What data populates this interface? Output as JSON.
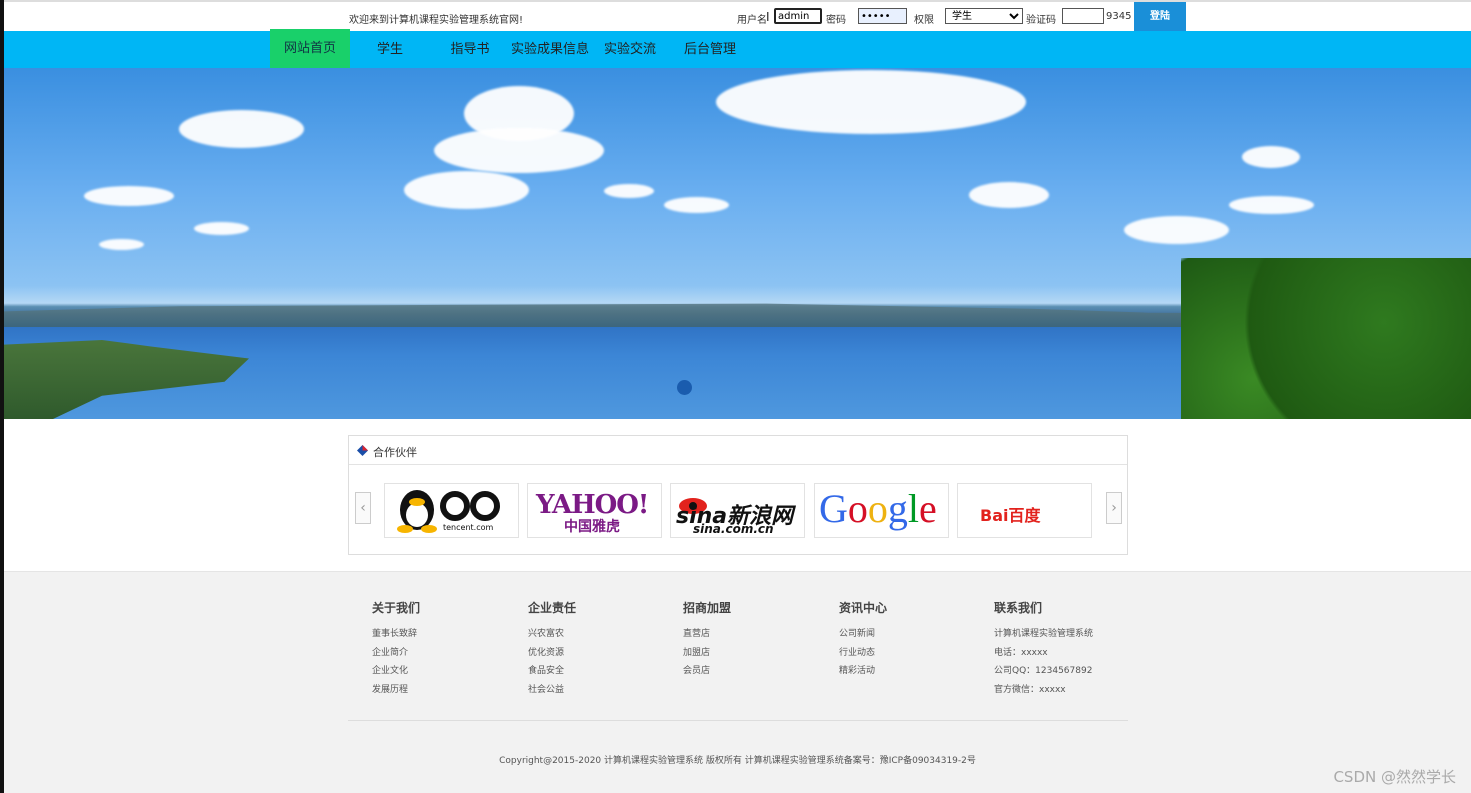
{
  "topbar": {
    "welcome": "欢迎来到计算机课程实验管理系统官网!",
    "username_label": "用户名",
    "username_value": "admin",
    "password_label": "密码",
    "password_value": "•••••",
    "role_label": "权限",
    "role_selected": "学生",
    "captcha_label": "验证码",
    "captcha_value": "",
    "captcha_code": "9345",
    "login_button": "登陆"
  },
  "nav": {
    "items": [
      {
        "label": "网站首页",
        "active": true
      },
      {
        "label": "学生"
      },
      {
        "label": "指导书"
      },
      {
        "label": "实验成果信息"
      },
      {
        "label": "实验交流"
      },
      {
        "label": "后台管理"
      }
    ]
  },
  "partners": {
    "title": "合作伙伴",
    "logos": [
      {
        "name": "QQ",
        "sub": "tencent.com"
      },
      {
        "name": "YAHOO!",
        "sub": "中国雅虎"
      },
      {
        "name": "sina新浪网",
        "sub": "sina.com.cn"
      },
      {
        "name": "Google"
      },
      {
        "name": "Bai百度"
      }
    ]
  },
  "footer": {
    "columns": [
      {
        "title": "关于我们",
        "links": [
          "董事长致辞",
          "企业简介",
          "企业文化",
          "发展历程"
        ]
      },
      {
        "title": "企业责任",
        "links": [
          "兴农富农",
          "优化资源",
          "食品安全",
          "社会公益"
        ]
      },
      {
        "title": "招商加盟",
        "links": [
          "直营店",
          "加盟店",
          "会员店"
        ]
      },
      {
        "title": "资讯中心",
        "links": [
          "公司新闻",
          "行业动态",
          "精彩活动"
        ]
      },
      {
        "title": "联系我们",
        "links": [
          "计算机课程实验管理系统",
          "电话：xxxxx",
          "公司QQ：1234567892",
          "官方微信：xxxxx"
        ]
      }
    ],
    "copyright": "Copyright@2015-2020 计算机课程实验管理系统 版权所有 计算机课程实验管理系统备案号：豫ICP备09034319-2号",
    "watermark": "CSDN @然然学长"
  },
  "colors": {
    "nav_bg": "#00b6f5",
    "nav_active": "#19d06a",
    "login_button": "#1a8fd8",
    "footer_bg": "#f2f2f2"
  }
}
